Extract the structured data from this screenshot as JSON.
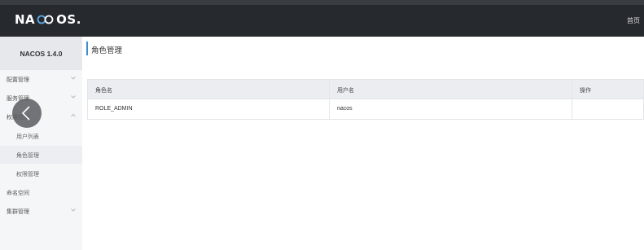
{
  "header": {
    "logo_text_left": "NA",
    "logo_text_right": "OS",
    "logo_dot": ".",
    "home_link": "首页"
  },
  "sidebar": {
    "version": "NACOS 1.4.0",
    "items": [
      {
        "label": "配置管理",
        "has_chevron": true,
        "expanded": false
      },
      {
        "label": "服务管理",
        "has_chevron": true,
        "expanded": false
      },
      {
        "label": "权限控制",
        "has_chevron": true,
        "expanded": true,
        "children": [
          {
            "label": "用户列表",
            "active": false
          },
          {
            "label": "角色管理",
            "active": true
          },
          {
            "label": "权限管理",
            "active": false
          }
        ]
      },
      {
        "label": "命名空间",
        "has_chevron": false
      },
      {
        "label": "集群管理",
        "has_chevron": true,
        "expanded": false
      }
    ]
  },
  "main": {
    "title": "角色管理",
    "table": {
      "columns": [
        "角色名",
        "用户名",
        "操作"
      ],
      "rows": [
        [
          "ROLE_ADMIN",
          "nacos",
          ""
        ]
      ]
    }
  },
  "colors": {
    "header_bg": "#26292e",
    "sidebar_bg": "#f5f6f7",
    "accent": "#3d8fd1"
  }
}
